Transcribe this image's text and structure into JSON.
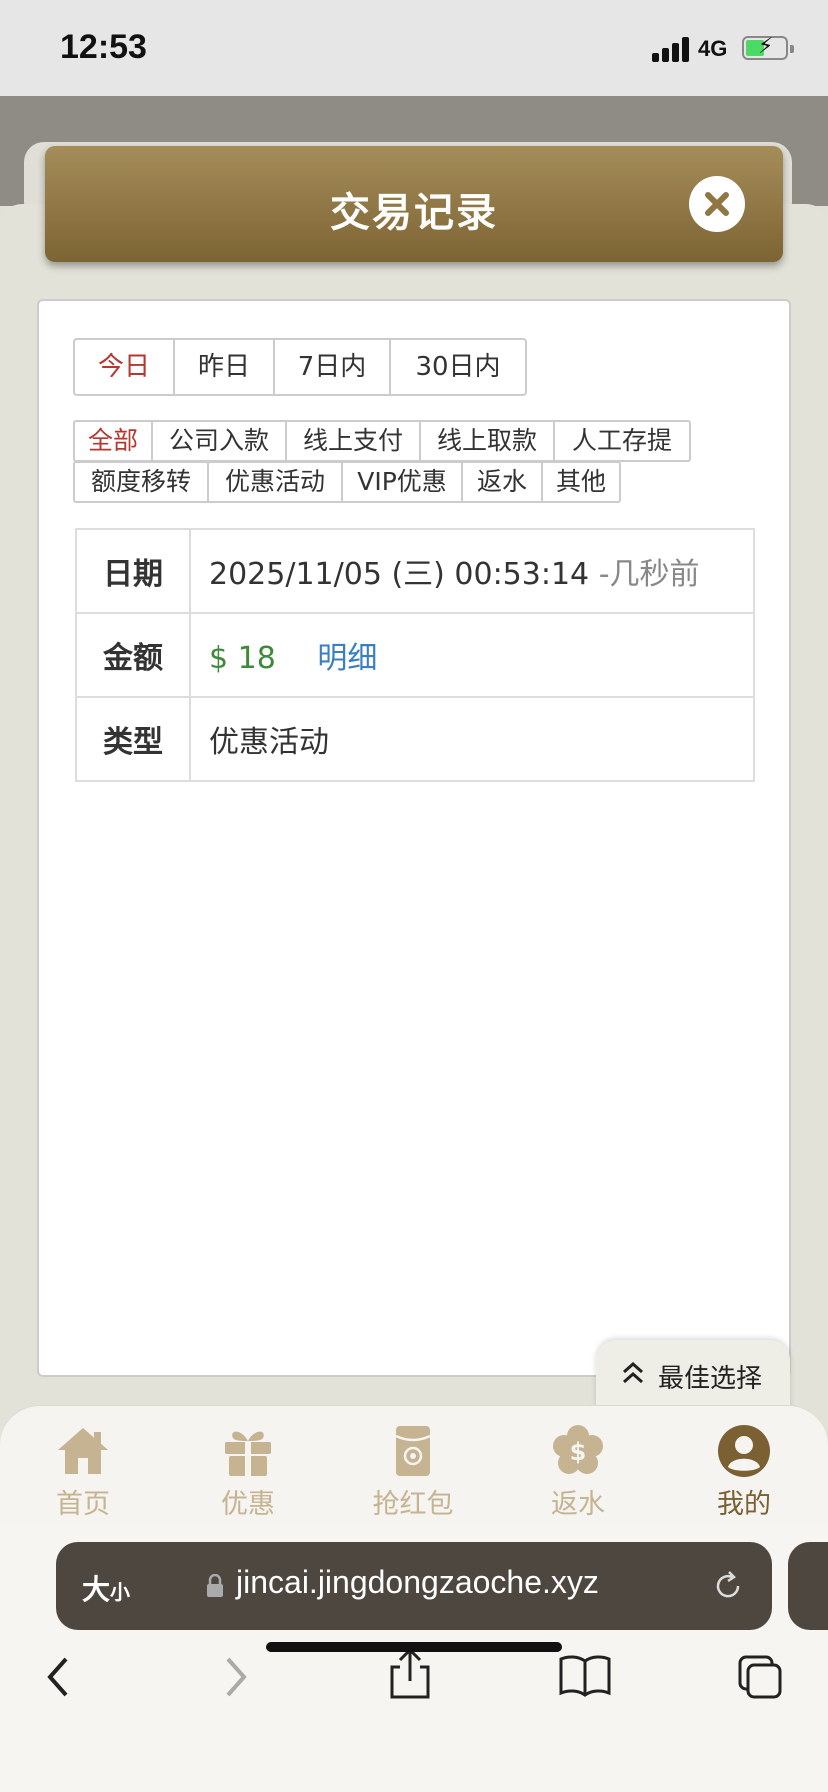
{
  "status_bar": {
    "time": "12:53",
    "network": "4G"
  },
  "modal": {
    "title": "交易记录"
  },
  "range_tabs": [
    {
      "label": "今日",
      "active": true
    },
    {
      "label": "昨日",
      "active": false
    },
    {
      "label": "7日内",
      "active": false
    },
    {
      "label": "30日内",
      "active": false
    }
  ],
  "type_tabs_row1": [
    {
      "label": "全部",
      "active": true
    },
    {
      "label": "公司入款",
      "active": false
    },
    {
      "label": "线上支付",
      "active": false
    },
    {
      "label": "线上取款",
      "active": false
    },
    {
      "label": "人工存提",
      "active": false
    }
  ],
  "type_tabs_row2": [
    {
      "label": "额度移转",
      "active": false
    },
    {
      "label": "优惠活动",
      "active": false
    },
    {
      "label": "VIP优惠",
      "active": false
    },
    {
      "label": "返水",
      "active": false
    },
    {
      "label": "其他",
      "active": false
    }
  ],
  "record": {
    "date_label": "日期",
    "date_value": "2025/11/05 (三) 00:53:14",
    "date_ago": "-几秒前",
    "amount_label": "金额",
    "amount_value": "$ 18",
    "detail_link": "明细",
    "type_label": "类型",
    "type_value": "优惠活动"
  },
  "floating": {
    "best_choice": "最佳选择"
  },
  "tabbar": [
    {
      "label": "首页",
      "icon": "home-icon",
      "active": false
    },
    {
      "label": "优惠",
      "icon": "gift-icon",
      "active": false
    },
    {
      "label": "抢红包",
      "icon": "red-envelope-icon",
      "active": false
    },
    {
      "label": "返水",
      "icon": "rebate-icon",
      "active": false
    },
    {
      "label": "我的",
      "icon": "user-icon",
      "active": true
    }
  ],
  "browser": {
    "text_size_big": "大",
    "text_size_small": "小",
    "url": "jincai.jingdongzaoche.xyz"
  },
  "colors": {
    "header_brown": "#8f7643",
    "active_red": "#b5372f",
    "amount_green": "#3f8a3a",
    "link_blue": "#3a7fbf",
    "tab_inactive": "#c5b391",
    "tab_active": "#7a6032"
  }
}
